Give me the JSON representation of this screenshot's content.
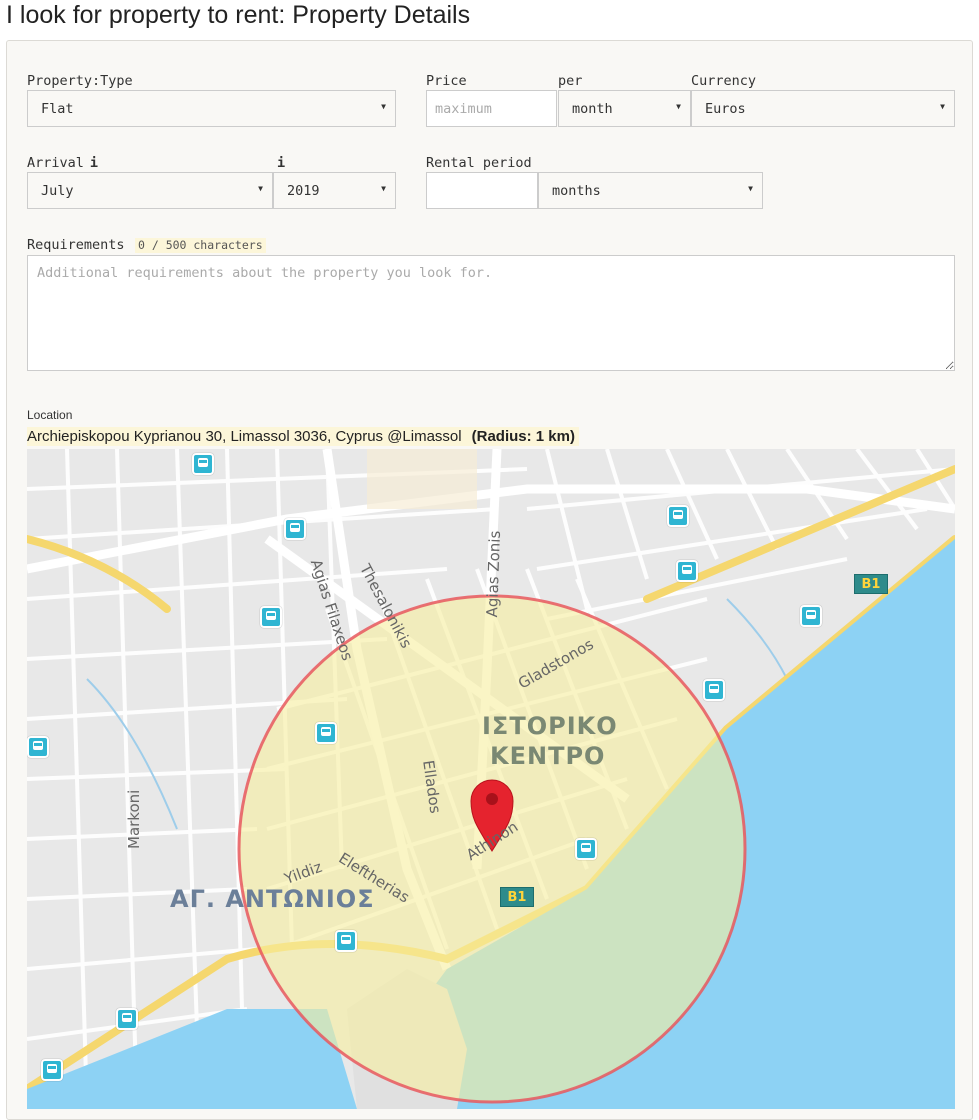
{
  "page": {
    "title": "I look for property to rent: Property Details"
  },
  "form": {
    "property_type": {
      "label": "Property:Type",
      "value": "Flat"
    },
    "price": {
      "label": "Price",
      "placeholder": "maximum"
    },
    "per": {
      "label": "per",
      "value": "month"
    },
    "currency": {
      "label": "Currency",
      "value": "Euros"
    },
    "arrival": {
      "label": "Arrival",
      "info": "i",
      "month": "July",
      "year": "2019",
      "year_info": "i"
    },
    "rental_period": {
      "label": "Rental period",
      "unit": "months"
    },
    "requirements": {
      "label": "Requirements",
      "counter": "0 / 500 characters",
      "placeholder": "Additional requirements about the property you look for."
    }
  },
  "location": {
    "label": "Location",
    "address": "Archiepiskopou Kyprianou 30, Limassol 3036, Cyprus @Limassol",
    "radius": "(Radius:  1 km)"
  },
  "map": {
    "streets": [
      "Agias Filaxeos",
      "Thesalonikis",
      "Agias Zonis",
      "Gladstonos",
      "Markoni",
      "Ellados",
      "Athinon",
      "Yildiz",
      "Eleftherias"
    ],
    "districts": [
      "ΙΣΤΟΡΙΚΟ",
      "ΚΕΝΤΡΟ",
      "ΑΓ. ΑΝΤΩΝΙΟΣ"
    ],
    "road_shields": [
      "B1",
      "B1"
    ],
    "colors": {
      "radius_fill": "#f6ef9e",
      "radius_stroke": "#e8585e",
      "sea": "#8dd2f4",
      "pin": "#e5232e"
    }
  }
}
